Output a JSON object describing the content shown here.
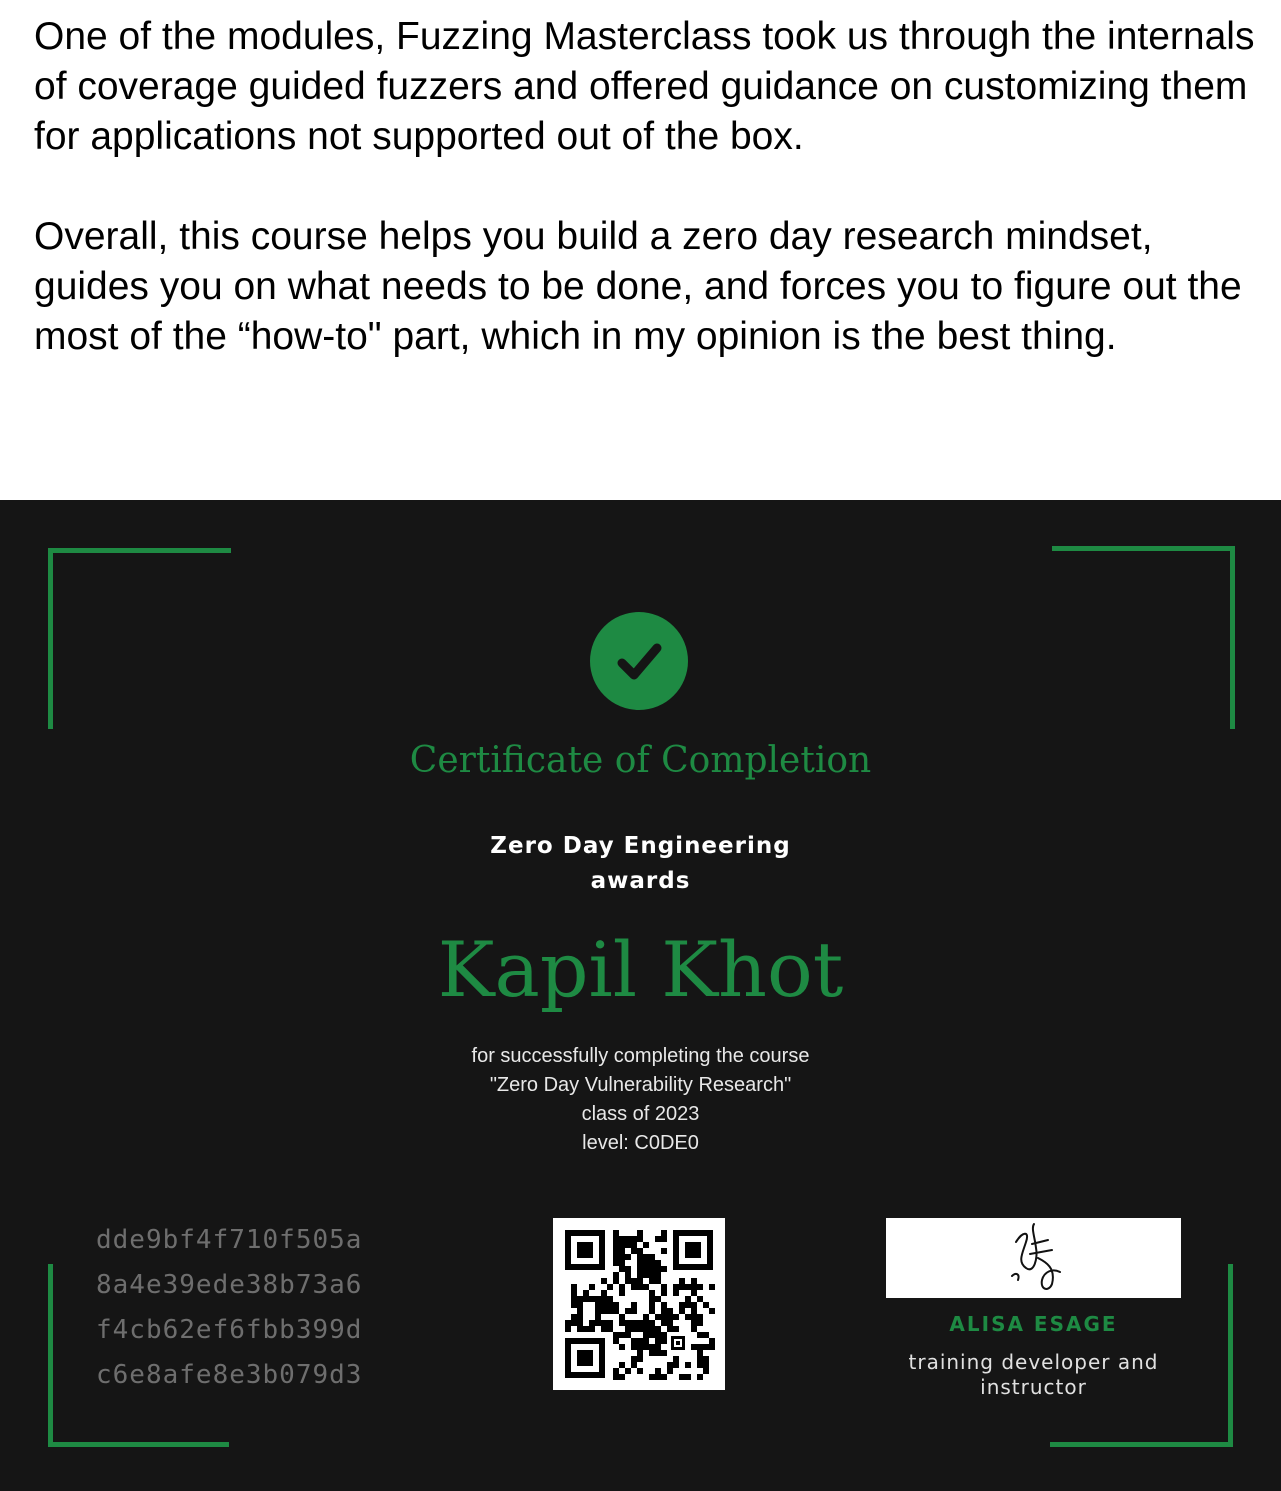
{
  "post": {
    "paragraph_1": "One of the modules, Fuzzing Masterclass took us through the internals of coverage guided fuzzers and offered guidance on customizing them for applications not supported out of the box.",
    "paragraph_2": "Overall, this course helps you build a zero day research mindset, guides you on what needs to be done, and forces you to figure out the most of the “how-to\" part, which in my opinion is the best thing."
  },
  "certificate": {
    "title": "Certificate of Completion",
    "issuer": "Zero Day Engineering",
    "awards_label": "awards",
    "recipient": "Kapil Khot",
    "details": {
      "line_1": "for successfully completing the course",
      "line_2": "\"Zero Day Vulnerability Research\"",
      "line_3": "class of 2023",
      "line_4": "level: C0DE0"
    },
    "hash_lines": [
      "dde9bf4f710f505a",
      "8a4e39ede38b73a6",
      "f4cb62ef6fbb399d",
      "c6e8afe8e3b079d3"
    ],
    "signer_name": "ALISA ESAGE",
    "signer_role": "training developer and instructor",
    "icons": {
      "badge": "checkmark-circle-icon",
      "qr": "qr-code",
      "signature": "handwritten-signature"
    },
    "colors": {
      "background": "#151515",
      "accent": "#1e8a43",
      "hash_text": "#6e6e6e"
    }
  }
}
